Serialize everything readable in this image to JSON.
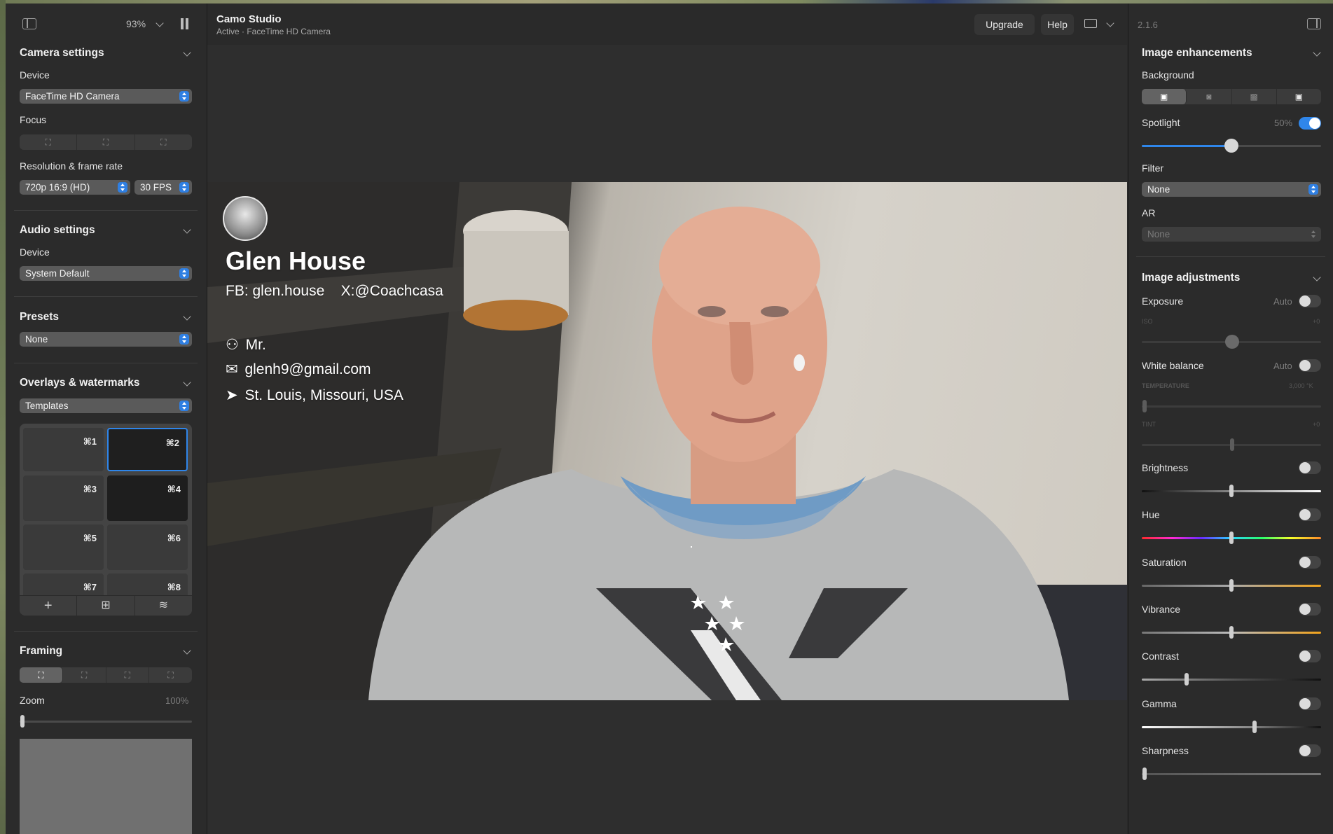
{
  "app": {
    "title": "Camo Studio",
    "subtitle": "Active · FaceTime HD Camera",
    "zoom": "93%",
    "version": "2.1.6",
    "accent": "#2f86ea"
  },
  "toolbar": {
    "upgrade": "Upgrade",
    "help": "Help"
  },
  "camera_settings": {
    "title": "Camera settings",
    "device_label": "Device",
    "device_value": "FaceTime HD Camera",
    "focus_label": "Focus",
    "resolution_label": "Resolution & frame rate",
    "resolution_value": "720p 16:9 (HD)",
    "fps_value": "30 FPS"
  },
  "audio_settings": {
    "title": "Audio settings",
    "device_label": "Device",
    "device_value": "System Default"
  },
  "presets": {
    "title": "Presets",
    "value": "None"
  },
  "overlays": {
    "title": "Overlays & watermarks",
    "value": "Templates",
    "tiles": [
      "⌘1",
      "⌘2",
      "⌘3",
      "⌘4",
      "⌘5",
      "⌘6",
      "⌘7",
      "⌘8"
    ],
    "selected_index": 1
  },
  "framing": {
    "title": "Framing",
    "zoom_label": "Zoom",
    "zoom_value": "100%"
  },
  "overlay_card": {
    "name": "Glen House",
    "social": "FB: glen.house    X:@Coachcasa",
    "honorific": "Mr.",
    "email": "glenh9@gmail.com",
    "location": "St. Louis, Missouri, USA"
  },
  "image_enhancements": {
    "title": "Image enhancements",
    "background_label": "Background",
    "spotlight_label": "Spotlight",
    "spotlight_value": "50%",
    "spotlight_level": 0.5,
    "spotlight_on": true,
    "filter_label": "Filter",
    "filter_value": "None",
    "ar_label": "AR",
    "ar_value": "None"
  },
  "image_adjustments": {
    "title": "Image adjustments",
    "exposure_label": "Exposure",
    "exposure_auto": "Auto",
    "iso_label": "ISO",
    "iso_value": "+0",
    "white_balance_label": "White balance",
    "white_balance_auto": "Auto",
    "temperature_label": "TEMPERATURE",
    "temperature_value": "3,000 °K",
    "tint_label": "TINT",
    "tint_value": "+0",
    "sliders": [
      {
        "label": "Brightness",
        "level": 0.5
      },
      {
        "label": "Hue",
        "level": 0.5
      },
      {
        "label": "Saturation",
        "level": 0.5
      },
      {
        "label": "Vibrance",
        "level": 0.5
      },
      {
        "label": "Contrast",
        "level": 0.25
      },
      {
        "label": "Gamma",
        "level": 0.63
      },
      {
        "label": "Sharpness",
        "level": 0.0
      }
    ]
  }
}
